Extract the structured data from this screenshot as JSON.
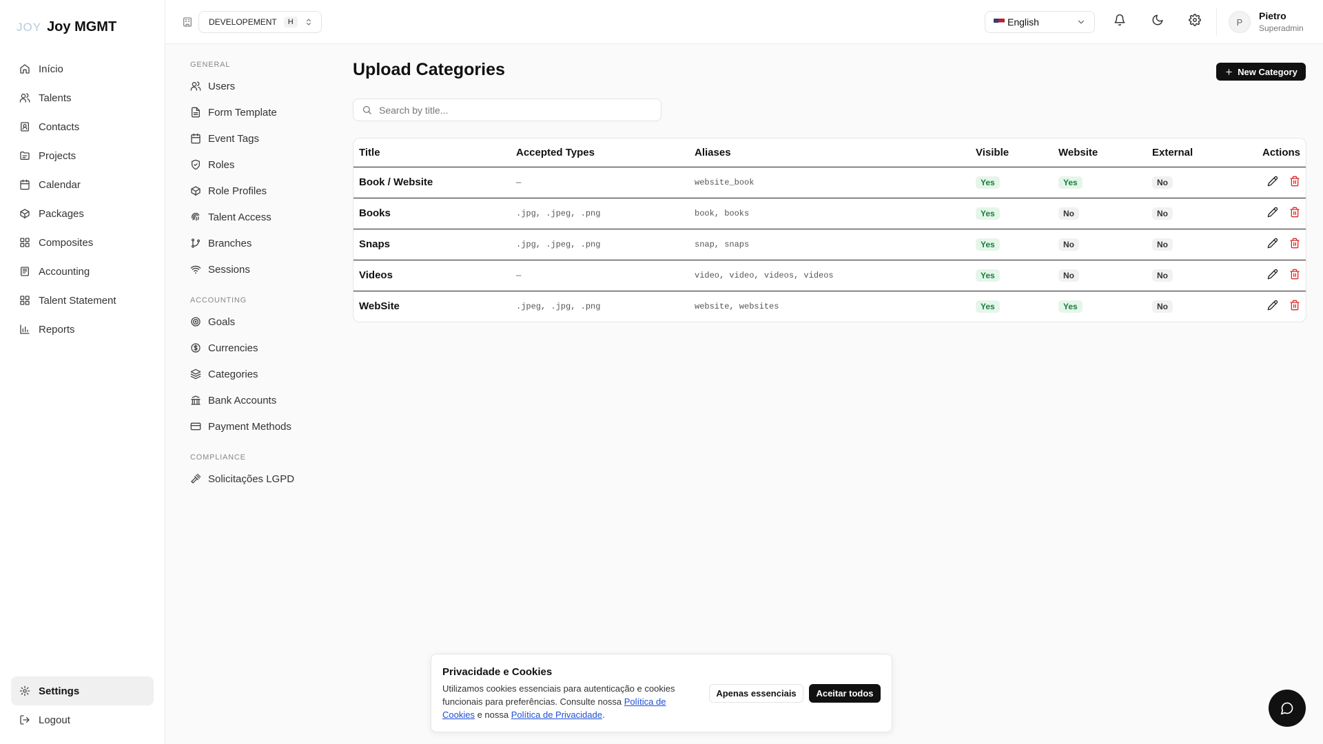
{
  "brand": {
    "mark": "JOY",
    "name": "Joy MGMT"
  },
  "sidebar": {
    "items": [
      {
        "label": "Início",
        "icon": "home-icon"
      },
      {
        "label": "Talents",
        "icon": "users-icon"
      },
      {
        "label": "Contacts",
        "icon": "contact-icon"
      },
      {
        "label": "Projects",
        "icon": "folder-icon"
      },
      {
        "label": "Calendar",
        "icon": "calendar-icon"
      },
      {
        "label": "Packages",
        "icon": "package-icon"
      },
      {
        "label": "Composites",
        "icon": "grid-icon"
      },
      {
        "label": "Accounting",
        "icon": "ledger-icon"
      },
      {
        "label": "Talent Statement",
        "icon": "grid-icon"
      },
      {
        "label": "Reports",
        "icon": "bar-chart-icon"
      }
    ],
    "bottom": [
      {
        "label": "Settings",
        "icon": "gear-icon",
        "active": true
      },
      {
        "label": "Logout",
        "icon": "logout-icon"
      }
    ]
  },
  "topbar": {
    "environment": "DEVELOPEMENT",
    "environment_tag": "H",
    "language": "English",
    "user": {
      "initial": "P",
      "name": "Pietro",
      "role": "Superadmin"
    }
  },
  "subnav": {
    "sections": [
      {
        "title": "GENERAL",
        "items": [
          {
            "label": "Users",
            "icon": "users-icon"
          },
          {
            "label": "Form Template",
            "icon": "file-icon"
          },
          {
            "label": "Event Tags",
            "icon": "calendar-icon"
          },
          {
            "label": "Roles",
            "icon": "shield-icon"
          },
          {
            "label": "Role Profiles",
            "icon": "package-icon"
          },
          {
            "label": "Talent Access",
            "icon": "fingerprint-icon"
          },
          {
            "label": "Branches",
            "icon": "git-branch-icon"
          },
          {
            "label": "Sessions",
            "icon": "wifi-icon"
          }
        ]
      },
      {
        "title": "ACCOUNTING",
        "items": [
          {
            "label": "Goals",
            "icon": "target-icon"
          },
          {
            "label": "Currencies",
            "icon": "dollar-icon"
          },
          {
            "label": "Categories",
            "icon": "layers-icon"
          },
          {
            "label": "Bank Accounts",
            "icon": "bank-icon"
          },
          {
            "label": "Payment Methods",
            "icon": "credit-card-icon"
          }
        ]
      },
      {
        "title": "COMPLIANCE",
        "items": [
          {
            "label": "Solicitações LGPD",
            "icon": "gavel-icon"
          }
        ]
      }
    ]
  },
  "main": {
    "title": "Upload Categories",
    "new_button": "New Category",
    "search_placeholder": "Search by title...",
    "columns": [
      "Title",
      "Accepted Types",
      "Aliases",
      "Visible",
      "Website",
      "External",
      "Actions"
    ],
    "rows": [
      {
        "title": "Book / Website",
        "types": "—",
        "aliases": "website_book",
        "visible": "Yes",
        "website": "Yes",
        "external": "No"
      },
      {
        "title": "Books",
        "types": ".jpg, .jpeg, .png",
        "aliases": "book, books",
        "visible": "Yes",
        "website": "No",
        "external": "No"
      },
      {
        "title": "Snaps",
        "types": ".jpg, .jpeg, .png",
        "aliases": "snap, snaps",
        "visible": "Yes",
        "website": "No",
        "external": "No"
      },
      {
        "title": "Videos",
        "types": "—",
        "aliases": "video, video, videos, videos",
        "visible": "Yes",
        "website": "No",
        "external": "No"
      },
      {
        "title": "WebSite",
        "types": ".jpeg, .jpg, .png",
        "aliases": "website, websites",
        "visible": "Yes",
        "website": "Yes",
        "external": "No"
      }
    ]
  },
  "cookie": {
    "title": "Privacidade e Cookies",
    "text_1": "Utilizamos cookies essenciais para autenticação e cookies funcionais para preferências. Consulte nossa ",
    "link_1": "Política de Cookies",
    "text_2": " e nossa ",
    "link_2": "Política de Privacidade",
    "text_3": ".",
    "essential_button": "Apenas essenciais",
    "accept_button": "Aceitar todos"
  },
  "colors": {
    "accent": "#111111",
    "yes_bg": "#e6f5ea",
    "yes_text": "#15803d",
    "danger": "#dc2626"
  }
}
